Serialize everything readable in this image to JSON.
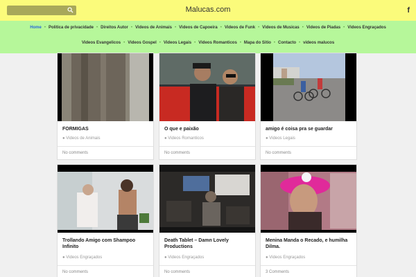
{
  "header": {
    "site_title": "Malucas.com",
    "search_icon": "search-icon",
    "facebook_icon": "f"
  },
  "nav": {
    "row1": [
      "Home",
      "Politica de privacidade",
      "Direitos Autor",
      "Videos de Animais",
      "Videos de Capoeira",
      "Videos de Funk",
      "Videos de Musicas",
      "Videos de Piadas",
      "Videos Engraçados"
    ],
    "row2": [
      "Videos Evangelicos",
      "Videos Gospel",
      "Videos Legais",
      "Videos Romanticos",
      "Mapa do Sitio",
      "Contacto",
      "videos malucos"
    ],
    "active": "Home"
  },
  "posts": [
    {
      "title": "FORMIGAS",
      "category": "Videos de Animais",
      "comments": "No comments"
    },
    {
      "title": "O que e paixão",
      "category": "Videos Romanticos",
      "comments": "No comments"
    },
    {
      "title": "amigo é coisa pra se guardar",
      "category": "Videos Legais",
      "comments": "No comments"
    },
    {
      "title": "Trollando Amigo com Shampoo Infinito",
      "category": "Videos Engraçados",
      "comments": "No comments"
    },
    {
      "title": "Death Tablet – Damn Lovely Productions",
      "category": "Videos Engraçados",
      "comments": "No comments"
    },
    {
      "title": "Menina Manda o Recado, e humilha Dilma.",
      "category": "Videos Engraçados",
      "comments": "3 Comments"
    }
  ]
}
